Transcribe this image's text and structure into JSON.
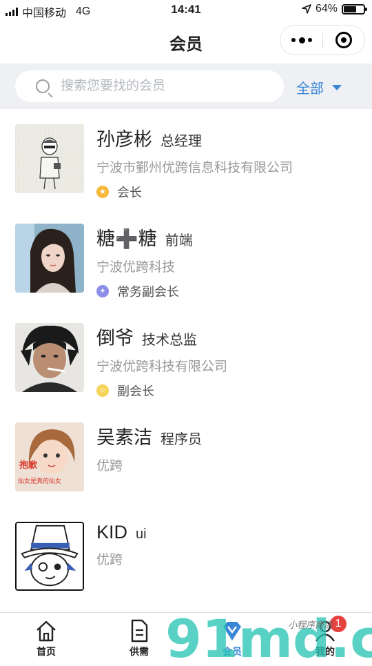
{
  "status_bar": {
    "carrier": "中国移动",
    "network": "4G",
    "time": "14:41",
    "battery": "64%",
    "battery_level": 0.64
  },
  "header": {
    "title": "会员"
  },
  "search": {
    "placeholder": "搜索您要找的会员",
    "filter_label": "全部"
  },
  "members": [
    {
      "name": "孙彦彬",
      "title": "总经理",
      "company": "宁波市鄞州优跨信息科技有限公司",
      "badge": "会长",
      "badge_icon": "star-icon",
      "badge_color": "#f6b93b"
    },
    {
      "name": "糖➕糖",
      "title": "前端",
      "company": "宁波优跨科技",
      "badge": "常务副会长",
      "badge_icon": "star-icon",
      "badge_color": "#8c8ee8"
    },
    {
      "name": "倒爷",
      "title": "技术总监",
      "company": "宁波优跨科技有限公司",
      "badge": "副会长",
      "badge_icon": "star-icon",
      "badge_color": "#f7d35a"
    },
    {
      "name": "吴素洁",
      "title": "程序员",
      "company": "优跨",
      "avatar_caption_1": "抱歉",
      "avatar_caption_2": "仙女是真的仙女"
    },
    {
      "name": "KID",
      "title": "ui",
      "company": "优跨"
    }
  ],
  "tabbar": {
    "items": [
      {
        "label": "首页",
        "icon": "home-icon"
      },
      {
        "label": "供需",
        "icon": "document-icon"
      },
      {
        "label": "会员",
        "icon": "member-icon",
        "active": true
      },
      {
        "label": "我的",
        "icon": "user-icon",
        "badge": "1"
      }
    ]
  },
  "watermark": {
    "text": "91md.com",
    "subtext": "小程序商店"
  },
  "colors": {
    "accent": "#3a86d6",
    "badge_red": "#e64340",
    "search_bg": "#eef0f3"
  }
}
